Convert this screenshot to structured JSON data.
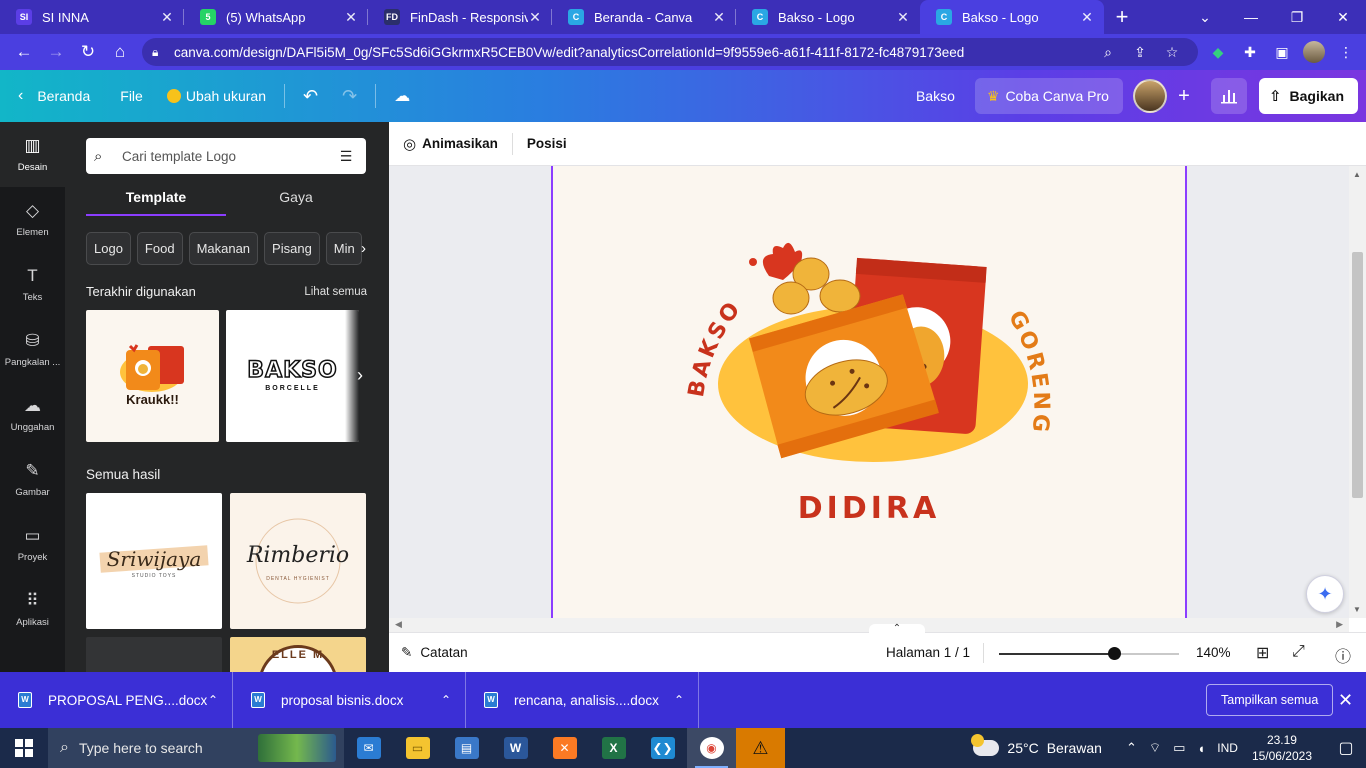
{
  "browser": {
    "tabs": [
      {
        "title": "SI INNA",
        "fav": "SI",
        "color": "#5b3ee6"
      },
      {
        "title": "(5) WhatsApp",
        "fav": "5",
        "color": "#25d366"
      },
      {
        "title": "FinDash - Responsive",
        "fav": "FD",
        "color": "#2b2f6b"
      },
      {
        "title": "Beranda - Canva",
        "fav": "C",
        "color": "#2aa7e4"
      },
      {
        "title": "Bakso - Logo",
        "fav": "C",
        "color": "#2aa7e4"
      },
      {
        "title": "Bakso - Logo",
        "fav": "C",
        "color": "#2aa7e4"
      }
    ],
    "url": "canva.com/design/DAFl5i5M_0g/SFc5Sd6iGGkrmxR5CEB0Vw/edit?analyticsCorrelationId=9f9559e6-a61f-411f-8172-fc4879173eed"
  },
  "canva": {
    "home": "Beranda",
    "file": "File",
    "resize": "Ubah ukuran",
    "design_name": "Bakso",
    "pro": "Coba Canva Pro",
    "share": "Bagikan"
  },
  "rail": [
    {
      "label": "Desain",
      "icon": "▥"
    },
    {
      "label": "Elemen",
      "icon": "◇"
    },
    {
      "label": "Teks",
      "icon": "T"
    },
    {
      "label": "Pangkalan ...",
      "icon": "⛁"
    },
    {
      "label": "Unggahan",
      "icon": "☁"
    },
    {
      "label": "Gambar",
      "icon": "✎"
    },
    {
      "label": "Proyek",
      "icon": "▭"
    },
    {
      "label": "Aplikasi",
      "icon": "⠿"
    }
  ],
  "panel": {
    "search_placeholder": "Cari template Logo",
    "tab_template": "Template",
    "tab_style": "Gaya",
    "chips": [
      "Logo",
      "Food",
      "Makanan",
      "Pisang",
      "Min"
    ],
    "recent_title": "Terakhir digunakan",
    "see_all": "Lihat semua",
    "all_results": "Semua hasil",
    "recent1_text": "Kraukk!!",
    "recent2_text": "BAKSO",
    "recent2_sub": "BORCELLE",
    "result1_text": "Sriwijaya",
    "result1_sub": "STUDIO TOYS",
    "result2_text": "Rimberio",
    "result2_sub": "DENTAL HYGIENIST",
    "result4_text": "ELLE M"
  },
  "editor": {
    "animate": "Animasikan",
    "position": "Posisi",
    "notes": "Catatan",
    "page_info": "Halaman 1 / 1",
    "zoom": "140%",
    "zoom_level": 0.64
  },
  "design": {
    "left_text": "BAKSO",
    "right_text": "GORENG",
    "brand": "DIDIRA",
    "colors": {
      "orange": "#f28a1a",
      "red": "#d8361f",
      "yellow": "#ffc23d",
      "text_red": "#c8321c",
      "text_orange": "#e37b17"
    }
  },
  "downloads": [
    {
      "name": "PROPOSAL PENG....docx"
    },
    {
      "name": "proposal bisnis.docx"
    },
    {
      "name": "rencana, analisis....docx"
    }
  ],
  "downloads_show_all": "Tampilkan semua",
  "taskbar": {
    "search_placeholder": "Type here to search",
    "temp": "25°C",
    "weather": "Berawan",
    "lang": "IND",
    "time": "23.19",
    "date": "15/06/2023"
  }
}
